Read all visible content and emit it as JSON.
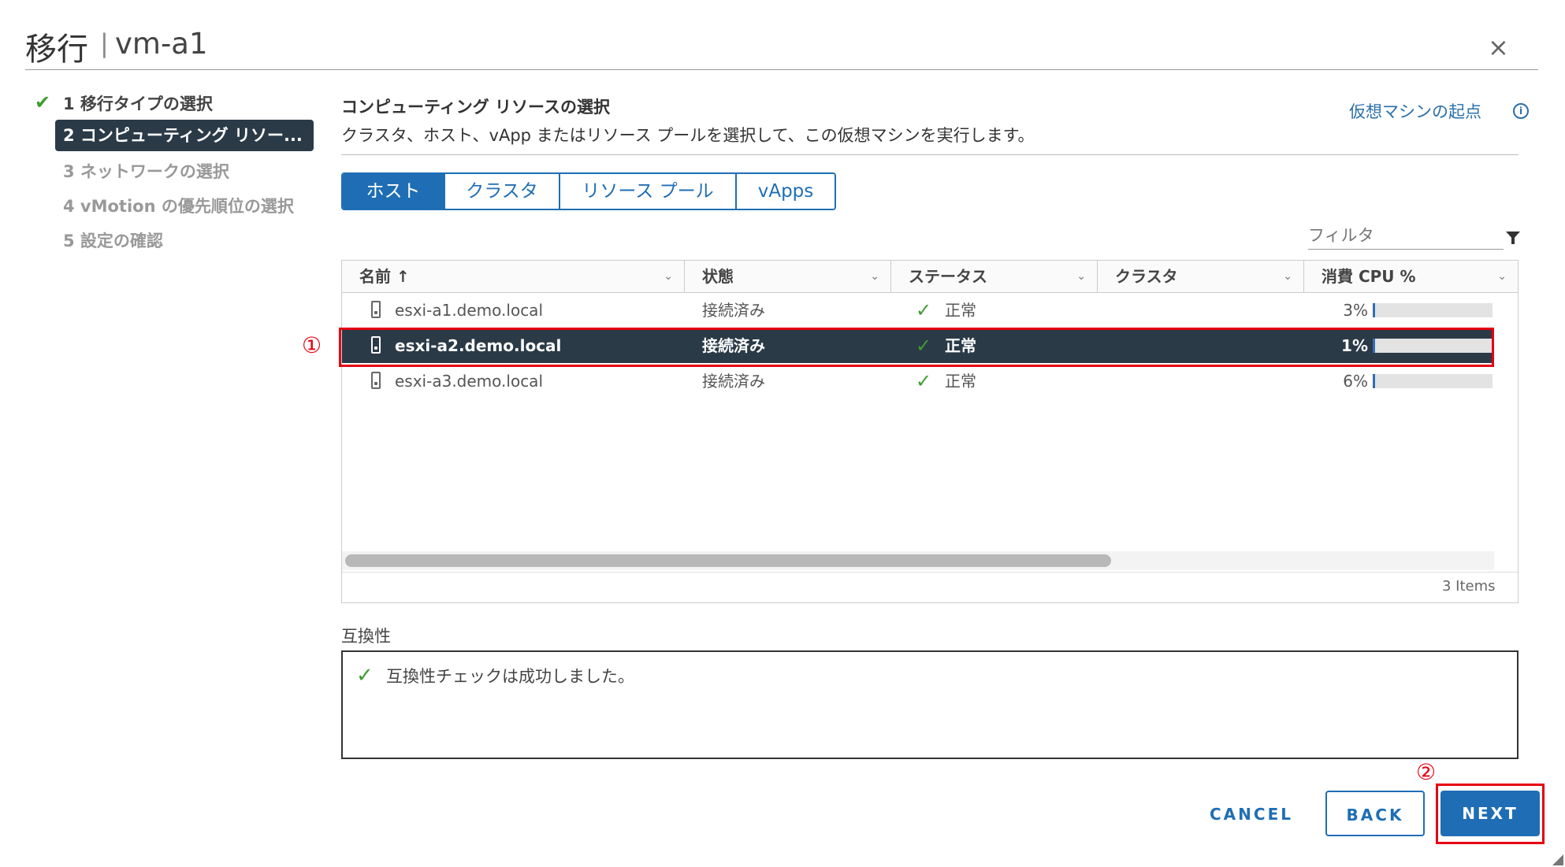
{
  "dialog": {
    "title": "移行",
    "separator": "|",
    "vm_name": "vm-a1",
    "close_icon": "×"
  },
  "steps": [
    {
      "label": "1 移行タイプの選択",
      "state": "done"
    },
    {
      "label": "2 コンピューティング リソー...",
      "state": "active"
    },
    {
      "label": "3 ネットワークの選択",
      "state": "pending"
    },
    {
      "label": "4 vMotion の優先順位の選択",
      "state": "pending"
    },
    {
      "label": "5 設定の確認",
      "state": "pending"
    }
  ],
  "content": {
    "title": "コンピューティング リソースの選択",
    "description": "クラスタ、ホスト、vApp またはリソース プールを選択して、この仮想マシンを実行します。",
    "vm_origin_link": "仮想マシンの起点",
    "info_icon": "i"
  },
  "tabs": [
    {
      "label": "ホスト",
      "active": true
    },
    {
      "label": "クラスタ",
      "active": false
    },
    {
      "label": "リソース プール",
      "active": false
    },
    {
      "label": "vApps",
      "active": false
    }
  ],
  "filter": {
    "placeholder": "フィルタ"
  },
  "grid": {
    "columns": [
      "名前 ↑",
      "状態",
      "ステータス",
      "クラスタ",
      "消費 CPU %"
    ],
    "rows": [
      {
        "name": "esxi-a1.demo.local",
        "state": "接続済み",
        "status": "正常",
        "cluster": "",
        "cpu": "3%",
        "cpu_value": 3,
        "selected": false
      },
      {
        "name": "esxi-a2.demo.local",
        "state": "接続済み",
        "status": "正常",
        "cluster": "",
        "cpu": "1%",
        "cpu_value": 1,
        "selected": true
      },
      {
        "name": "esxi-a3.demo.local",
        "state": "接続済み",
        "status": "正常",
        "cluster": "",
        "cpu": "6%",
        "cpu_value": 6,
        "selected": false
      }
    ],
    "items_count": "3 Items",
    "status_icon": "check-icon",
    "row_icon": "host-server-icon"
  },
  "compatibility": {
    "label": "互換性",
    "message": "互換性チェックは成功しました。"
  },
  "footer": {
    "cancel": "CANCEL",
    "back": "BACK",
    "next": "NEXT"
  },
  "annotations": {
    "marker_1": "①",
    "marker_2": "②",
    "highlight_color": "#e60012"
  },
  "colors": {
    "accent": "#1f6eb5",
    "selected_row": "#2b3a47",
    "ok_green": "#3d9d2e"
  }
}
